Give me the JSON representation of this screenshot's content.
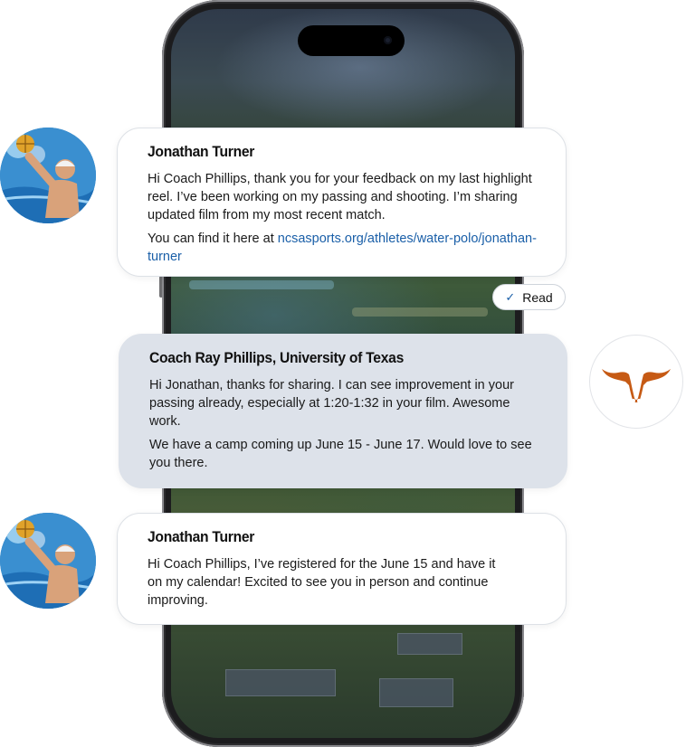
{
  "messages": [
    {
      "sender": "Jonathan Turner",
      "paragraphs": [
        "Hi Coach Phillips, thank you for your feedback on my last highlight reel. I’ve been working on my passing and shooting. I’m sharing updated film from my most recent match."
      ],
      "link_prefix": "You can find it here at ",
      "link_text": "ncsasports.org/athletes/water-polo/jonathan-turner"
    },
    {
      "sender": "Coach Ray Phillips, University of Texas",
      "paragraphs": [
        "Hi Jonathan, thanks for sharing. I can see improvement in your passing already, especially at 1:20-1:32 in your film. Awesome work.",
        "We have a camp coming up June 15 - June 17. Would love to see you there."
      ]
    },
    {
      "sender": "Jonathan Turner",
      "paragraphs": [
        "Hi Coach Phillips, I’ve registered for the June 15 and have it on my calendar! Excited to see you in person and continue improving."
      ]
    }
  ],
  "read_receipt": {
    "label": "Read",
    "icon": "check-icon"
  },
  "avatars": {
    "athlete": "water-polo-player-avatar",
    "coach": "longhorn-logo-icon"
  },
  "colors": {
    "coach_bubble": "#dde2ea",
    "athlete_bubble": "#ffffff",
    "link": "#1a5fa8",
    "logo": "#c65a14"
  }
}
